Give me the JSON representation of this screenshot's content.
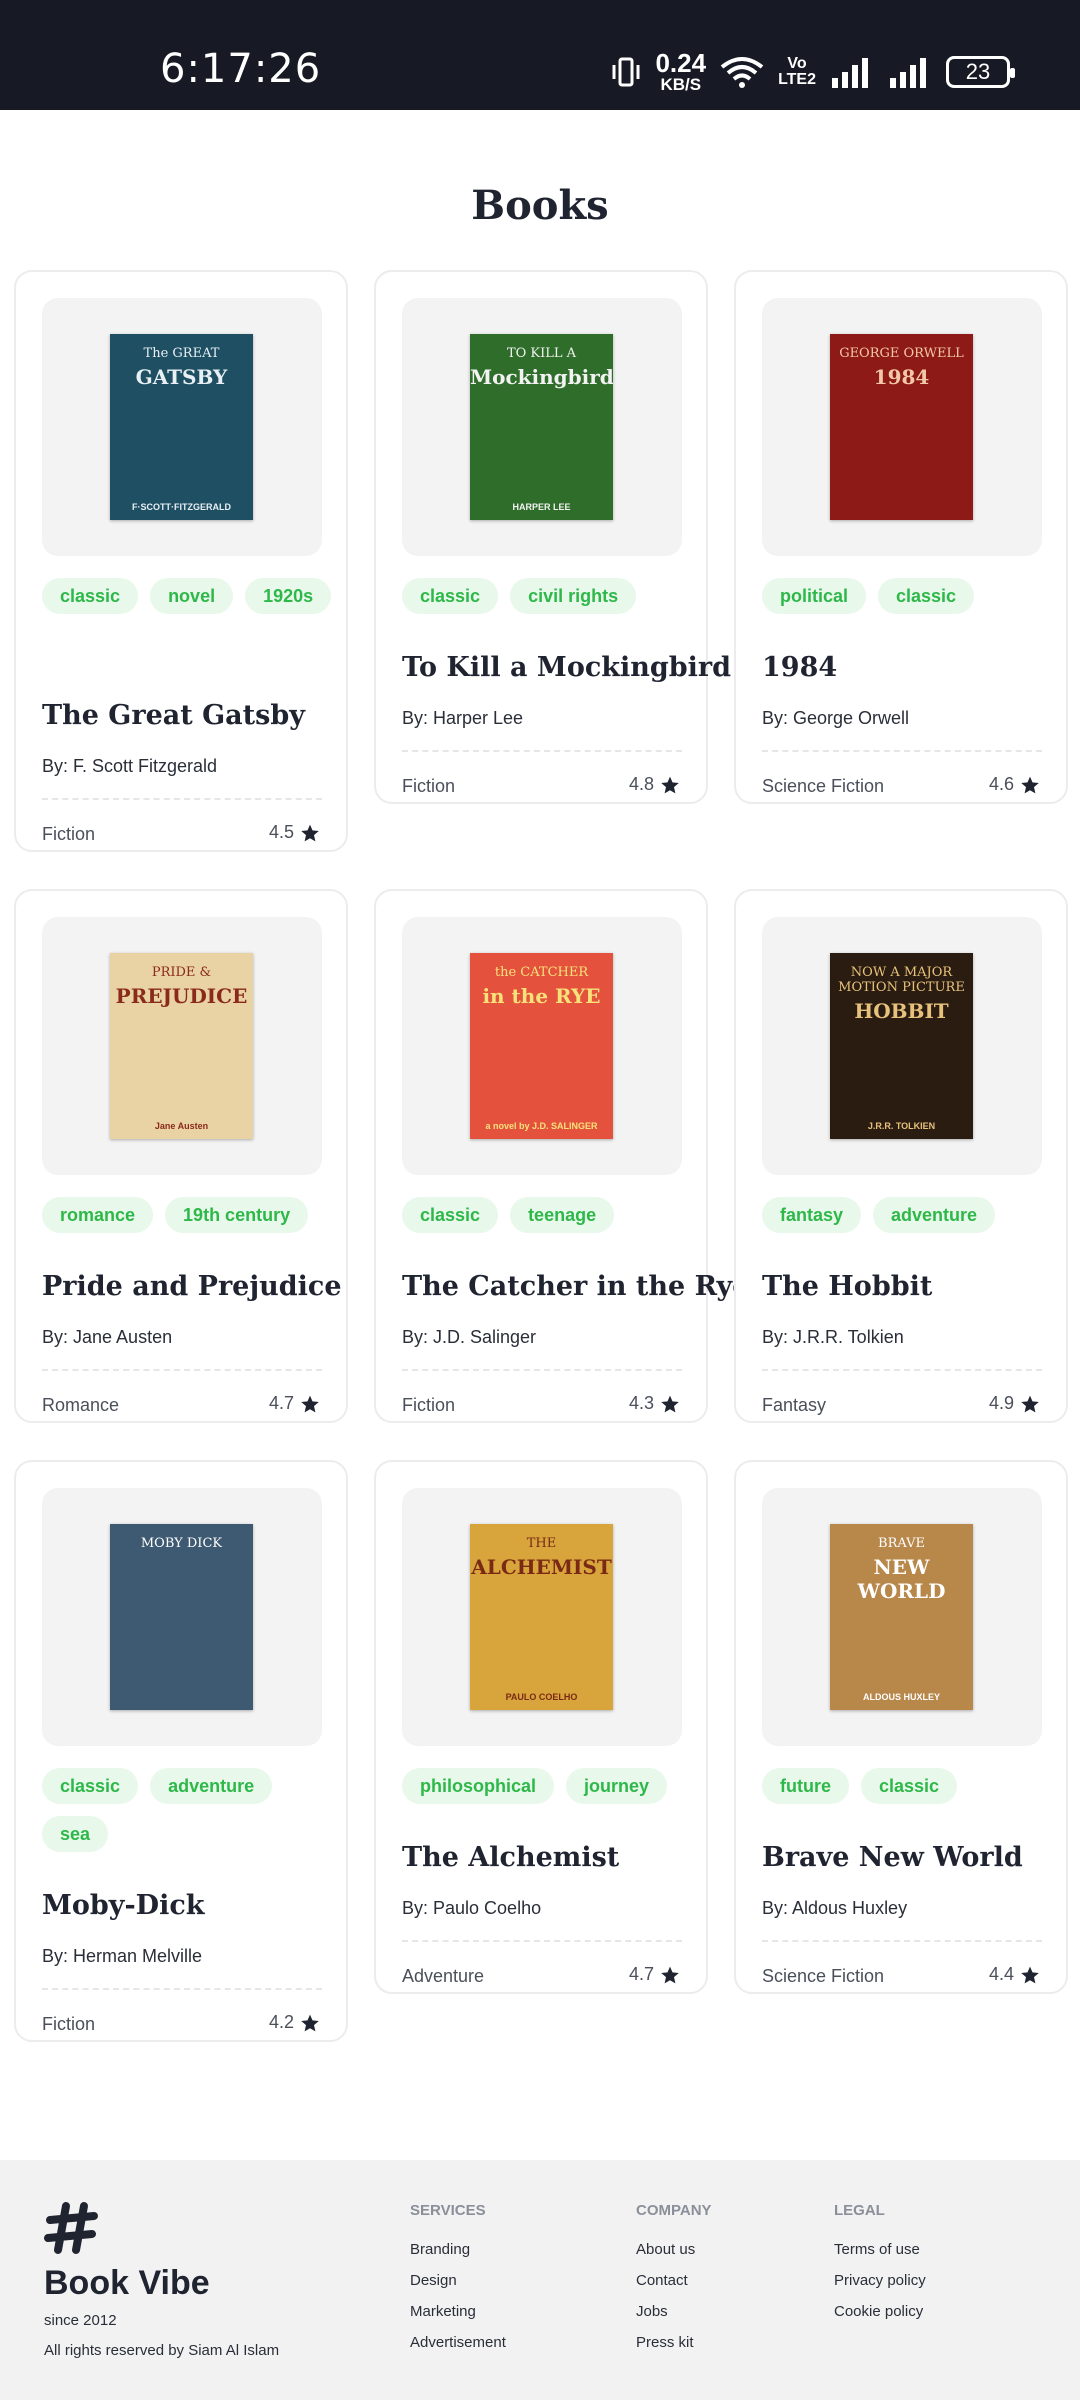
{
  "status_bar": {
    "time": "6:17:26",
    "net_speed": "0.24",
    "net_unit": "KB/S",
    "volte_top": "Vo",
    "volte_bottom": "LTE2",
    "battery": "23"
  },
  "page": {
    "title": "Books"
  },
  "books": [
    {
      "tags": [
        "classic",
        "novel",
        "1920s"
      ],
      "title": "The Great Gatsby",
      "author": "By: F. Scott Fitzgerald",
      "genre": "Fiction",
      "rating": "4.5",
      "cover": {
        "line1": "The GREAT",
        "line2": "GATSBY",
        "bottom": "F·SCOTT·FITZGERALD",
        "bg": "#1f4f63",
        "fg": "#e8f0f5"
      }
    },
    {
      "tags": [
        "classic",
        "civil rights"
      ],
      "title": "To Kill a Mockingbird",
      "author": "By: Harper Lee",
      "genre": "Fiction",
      "rating": "4.8",
      "cover": {
        "line1": "TO KILL A",
        "line2": "Mockingbird",
        "bottom": "HARPER LEE",
        "bg": "#2f6e2a",
        "fg": "#f2f2f2"
      }
    },
    {
      "tags": [
        "political",
        "classic"
      ],
      "title": "1984",
      "author": "By: George Orwell",
      "genre": "Science Fiction",
      "rating": "4.6",
      "cover": {
        "line1": "GEORGE ORWELL",
        "line2": "1984",
        "bottom": "",
        "bg": "#8e1a17",
        "fg": "#f3c8a8"
      }
    },
    {
      "tags": [
        "romance",
        "19th century"
      ],
      "title": "Pride and Prejudice",
      "author": "By: Jane Austen",
      "genre": "Romance",
      "rating": "4.7",
      "cover": {
        "line1": "PRIDE &",
        "line2": "PREJUDICE",
        "bottom": "Jane Austen",
        "bg": "#e9d2a4",
        "fg": "#8a2a1a"
      }
    },
    {
      "tags": [
        "classic",
        "teenage"
      ],
      "title": "The Catcher in the Rye",
      "author": "By: J.D. Salinger",
      "genre": "Fiction",
      "rating": "4.3",
      "cover": {
        "line1": "the CATCHER",
        "line2": "in the RYE",
        "bottom": "a novel by J.D. SALINGER",
        "bg": "#e4523e",
        "fg": "#f7e27a"
      }
    },
    {
      "tags": [
        "fantasy",
        "adventure"
      ],
      "title": "The Hobbit",
      "author": "By: J.R.R. Tolkien",
      "genre": "Fantasy",
      "rating": "4.9",
      "cover": {
        "line1": "NOW A MAJOR MOTION PICTURE",
        "line2": "HOBBIT",
        "bottom": "J.R.R. TOLKIEN",
        "bg": "#2b1c12",
        "fg": "#e6c27a"
      }
    },
    {
      "tags": [
        "classic",
        "adventure",
        "sea"
      ],
      "title": "Moby-Dick",
      "author": "By: Herman Melville",
      "genre": "Fiction",
      "rating": "4.2",
      "cover": {
        "line1": "MOBY DICK",
        "line2": "",
        "bottom": "",
        "bg": "#3d5a72",
        "fg": "#ffffff"
      }
    },
    {
      "tags": [
        "philosophical",
        "journey"
      ],
      "title": "The Alchemist",
      "author": "By: Paulo Coelho",
      "genre": "Adventure",
      "rating": "4.7",
      "cover": {
        "line1": "THE",
        "line2": "ALCHEMIST",
        "bottom": "PAULO COELHO",
        "bg": "#d8a53c",
        "fg": "#7a2a14"
      }
    },
    {
      "tags": [
        "future",
        "classic"
      ],
      "title": "Brave New World",
      "author": "By: Aldous Huxley",
      "genre": "Science Fiction",
      "rating": "4.4",
      "cover": {
        "line1": "BRAVE",
        "line2": "NEW WORLD",
        "bottom": "ALDOUS HUXLEY",
        "bg": "#b8874a",
        "fg": "#ffffff"
      }
    }
  ],
  "footer": {
    "brand": "Book Vibe",
    "since": "since 2012",
    "rights": "All rights reserved by Siam Al Islam",
    "columns": [
      {
        "heading": "SERVICES",
        "links": [
          "Branding",
          "Design",
          "Marketing",
          "Advertisement"
        ]
      },
      {
        "heading": "COMPANY",
        "links": [
          "About us",
          "Contact",
          "Jobs",
          "Press kit"
        ]
      },
      {
        "heading": "LEGAL",
        "links": [
          "Terms of use",
          "Privacy policy",
          "Cookie policy"
        ]
      }
    ]
  },
  "colors": {
    "tag_bg": "#e8f8ea",
    "tag_fg": "#2fb84a",
    "status_bg": "#171a24",
    "footer_bg": "#f2f2f2"
  }
}
